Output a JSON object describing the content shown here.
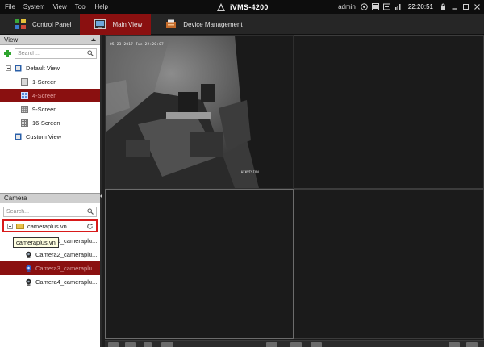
{
  "menu": {
    "items": [
      "File",
      "System",
      "View",
      "Tool",
      "Help"
    ]
  },
  "app": {
    "title": "iVMS-4200"
  },
  "status": {
    "user": "admin",
    "time": "22:20:51"
  },
  "tabs": [
    {
      "label": "Control Panel",
      "active": false,
      "icon": "control-panel-icon"
    },
    {
      "label": "Main View",
      "active": true,
      "icon": "main-view-icon"
    },
    {
      "label": "Device Management",
      "active": false,
      "icon": "device-management-icon"
    }
  ],
  "view_panel": {
    "header": "View",
    "search_placeholder": "Search...",
    "tree": {
      "default_view": "Default View",
      "items": [
        "1-Screen",
        "4-Screen",
        "9-Screen",
        "16-Screen"
      ],
      "selected": "4-Screen",
      "custom_view": "Custom View"
    }
  },
  "camera_panel": {
    "header": "Camera",
    "search_placeholder": "Search...",
    "group": "cameraplus.vn",
    "tooltip": "cameraplus.vn",
    "cameras": [
      "Camera1_cameraplu...",
      "Camera2_cameraplu...",
      "Camera3_cameraplu...",
      "Camera4_cameraplu..."
    ],
    "selected_camera": "Camera3_cameraplu..."
  },
  "video": {
    "osd_datetime": "05-23-2017 Tue 22:20:07",
    "osd_channel": "HIKVISION"
  },
  "colors": {
    "accent": "#8a1010",
    "highlight_border": "#d81a1a"
  }
}
